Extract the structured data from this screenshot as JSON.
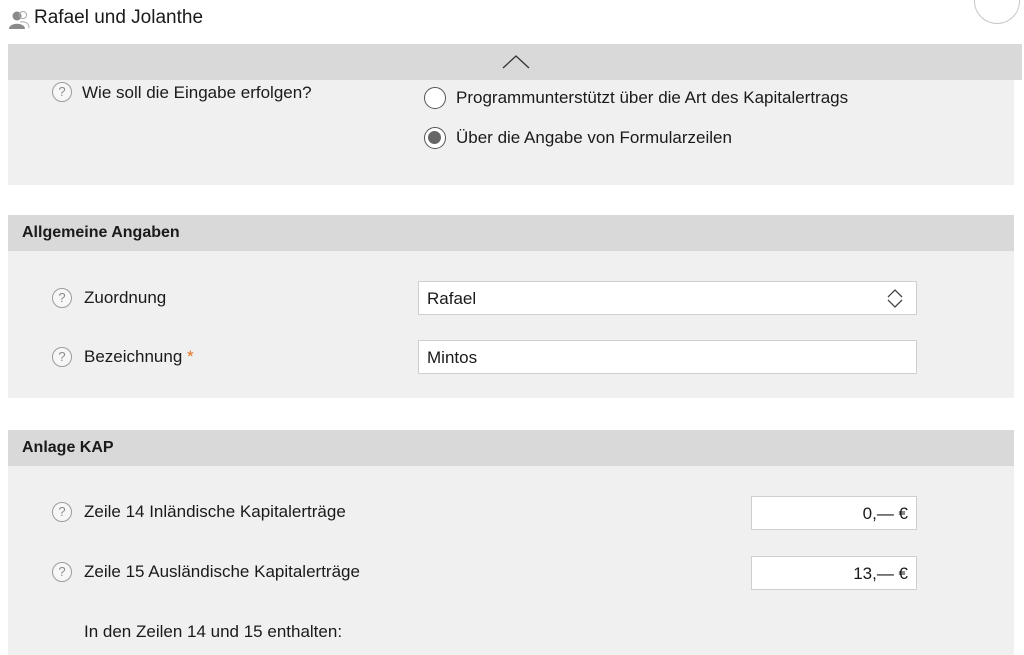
{
  "header": {
    "title": "Rafael und Jolanthe",
    "icon": "user-icon"
  },
  "input_mode": {
    "question": "Wie soll die Eingabe erfolgen?",
    "options": [
      {
        "label": "Programmunterstützt über die Art des Kapitalertrags",
        "selected": false
      },
      {
        "label": "Über die Angabe von Formularzeilen",
        "selected": true
      }
    ]
  },
  "general": {
    "title": "Allgemeine Angaben",
    "assignment_label": "Zuordnung",
    "assignment_value": "Rafael",
    "name_label": "Bezeichnung",
    "required_mark": "*",
    "name_value": "Mintos"
  },
  "kap": {
    "title": "Anlage KAP",
    "rows": [
      {
        "label": "Zeile 14 Inländische Kapitalerträge",
        "value": "0,— €"
      },
      {
        "label": "Zeile 15 Ausländische Kapitalerträge",
        "value": "13,— €"
      }
    ],
    "note": "In den Zeilen 14 und 15 enthalten:"
  },
  "help_glyph": "?"
}
